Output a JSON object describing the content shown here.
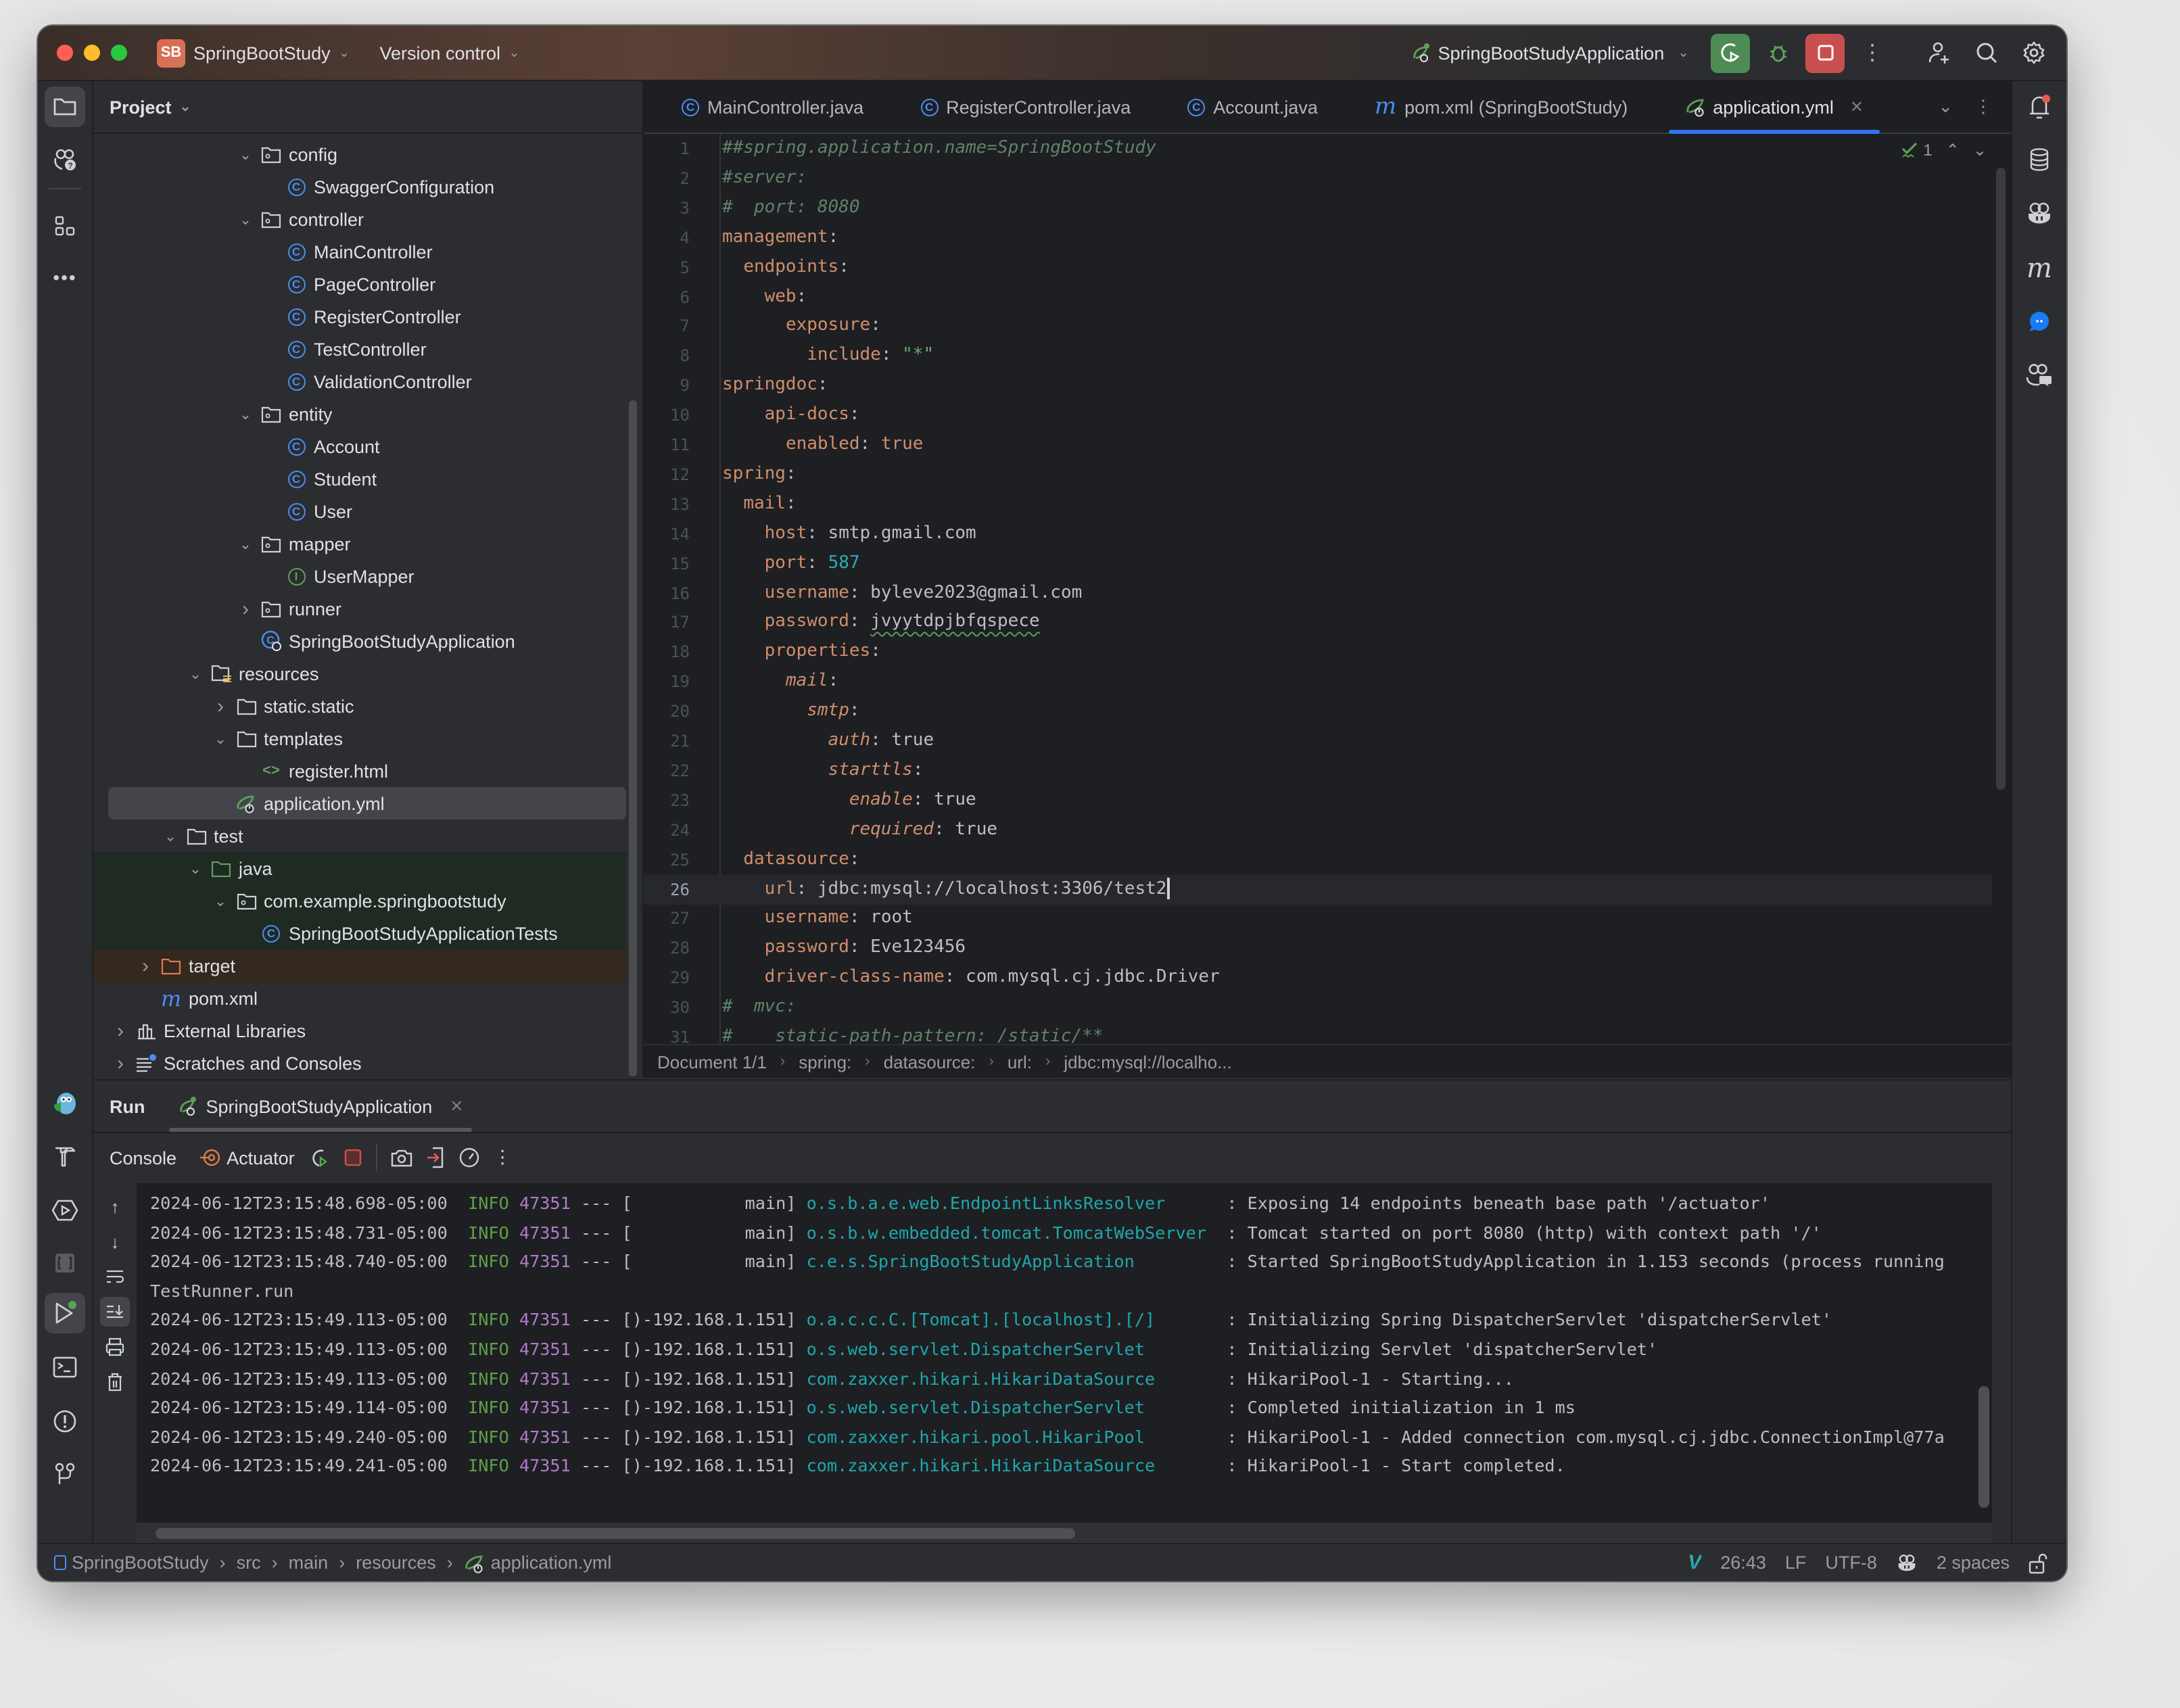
{
  "titlebar": {
    "project_badge": "SB",
    "project_name": "SpringBootStudy",
    "version_control": "Version control",
    "run_config": "SpringBootStudyApplication"
  },
  "project_panel": {
    "title": "Project",
    "tree": [
      {
        "label": "config",
        "type": "package",
        "expanded": true,
        "depth": 3
      },
      {
        "label": "SwaggerConfiguration",
        "type": "class",
        "depth": 4
      },
      {
        "label": "controller",
        "type": "package",
        "expanded": true,
        "depth": 3
      },
      {
        "label": "MainController",
        "type": "class",
        "depth": 4
      },
      {
        "label": "PageController",
        "type": "class",
        "depth": 4
      },
      {
        "label": "RegisterController",
        "type": "class",
        "depth": 4
      },
      {
        "label": "TestController",
        "type": "class",
        "depth": 4
      },
      {
        "label": "ValidationController",
        "type": "class",
        "depth": 4
      },
      {
        "label": "entity",
        "type": "package",
        "expanded": true,
        "depth": 3
      },
      {
        "label": "Account",
        "type": "class",
        "depth": 4
      },
      {
        "label": "Student",
        "type": "class",
        "depth": 4
      },
      {
        "label": "User",
        "type": "class",
        "depth": 4
      },
      {
        "label": "mapper",
        "type": "package",
        "expanded": true,
        "depth": 3
      },
      {
        "label": "UserMapper",
        "type": "interface",
        "depth": 4
      },
      {
        "label": "runner",
        "type": "package",
        "expanded": false,
        "depth": 3
      },
      {
        "label": "SpringBootStudyApplication",
        "type": "spring-class",
        "depth": 3
      },
      {
        "label": "resources",
        "type": "resources",
        "expanded": true,
        "depth": 1
      },
      {
        "label": "static.static",
        "type": "folder",
        "expanded": false,
        "depth": 2
      },
      {
        "label": "templates",
        "type": "folder",
        "expanded": true,
        "depth": 2
      },
      {
        "label": "register.html",
        "type": "html",
        "depth": 3
      },
      {
        "label": "application.yml",
        "type": "spring-yml",
        "depth": 2,
        "selected": true
      },
      {
        "label": "test",
        "type": "folder",
        "expanded": true,
        "depth": 0
      },
      {
        "label": "java",
        "type": "test-folder",
        "expanded": true,
        "depth": 1,
        "test": true
      },
      {
        "label": "com.example.springbootstudy",
        "type": "package",
        "expanded": true,
        "depth": 2,
        "test": true
      },
      {
        "label": "SpringBootStudyApplicationTests",
        "type": "class",
        "depth": 3,
        "test": true
      },
      {
        "label": "target",
        "type": "excluded-folder",
        "expanded": false,
        "depth": -1,
        "excluded": true
      },
      {
        "label": "pom.xml",
        "type": "maven",
        "depth": -1
      },
      {
        "label": "External Libraries",
        "type": "libraries",
        "expanded": false,
        "depth": -2
      },
      {
        "label": "Scratches and Consoles",
        "type": "scratches",
        "expanded": false,
        "depth": -2
      }
    ]
  },
  "editor": {
    "tabs": [
      {
        "label": "MainController.java",
        "icon": "class"
      },
      {
        "label": "RegisterController.java",
        "icon": "class"
      },
      {
        "label": "Account.java",
        "icon": "class"
      },
      {
        "label": "pom.xml (SpringBootStudy)",
        "icon": "maven"
      },
      {
        "label": "application.yml",
        "icon": "spring-yml",
        "active": true
      }
    ],
    "inspection_count": "1",
    "current_line": 26,
    "lines": [
      [
        {
          "t": "##spring.application.name=SpringBootStudy",
          "c": "cm"
        }
      ],
      [
        {
          "t": "#server:",
          "c": "cm"
        }
      ],
      [
        {
          "t": "#  port: 8080",
          "c": "cm"
        }
      ],
      [
        {
          "t": "management",
          "c": "k"
        },
        {
          "t": ":"
        }
      ],
      [
        {
          "t": "  "
        },
        {
          "t": "endpoints",
          "c": "k"
        },
        {
          "t": ":"
        }
      ],
      [
        {
          "t": "    "
        },
        {
          "t": "web",
          "c": "k"
        },
        {
          "t": ":"
        }
      ],
      [
        {
          "t": "      "
        },
        {
          "t": "exposure",
          "c": "k"
        },
        {
          "t": ":"
        }
      ],
      [
        {
          "t": "        "
        },
        {
          "t": "include",
          "c": "k"
        },
        {
          "t": ": "
        },
        {
          "t": "\"*\"",
          "c": "str"
        }
      ],
      [
        {
          "t": "springdoc",
          "c": "k"
        },
        {
          "t": ":"
        }
      ],
      [
        {
          "t": "    "
        },
        {
          "t": "api-docs",
          "c": "k"
        },
        {
          "t": ":"
        }
      ],
      [
        {
          "t": "      "
        },
        {
          "t": "enabled",
          "c": "k"
        },
        {
          "t": ": "
        },
        {
          "t": "true",
          "c": "kw"
        }
      ],
      [
        {
          "t": "spring",
          "c": "k"
        },
        {
          "t": ":"
        }
      ],
      [
        {
          "t": "  "
        },
        {
          "t": "mail",
          "c": "k"
        },
        {
          "t": ":"
        }
      ],
      [
        {
          "t": "    "
        },
        {
          "t": "host",
          "c": "k"
        },
        {
          "t": ": smtp.gmail.com"
        }
      ],
      [
        {
          "t": "    "
        },
        {
          "t": "port",
          "c": "k"
        },
        {
          "t": ": "
        },
        {
          "t": "587",
          "c": "num"
        }
      ],
      [
        {
          "t": "    "
        },
        {
          "t": "username",
          "c": "k"
        },
        {
          "t": ": byleve2023@gmail.com"
        }
      ],
      [
        {
          "t": "    "
        },
        {
          "t": "password",
          "c": "k"
        },
        {
          "t": ": "
        },
        {
          "t": "jvyytdpjbfqspece",
          "c": "typo"
        }
      ],
      [
        {
          "t": "    "
        },
        {
          "t": "properties",
          "c": "k"
        },
        {
          "t": ":"
        }
      ],
      [
        {
          "t": "      "
        },
        {
          "t": "mail",
          "c": "k i"
        },
        {
          "t": ":"
        }
      ],
      [
        {
          "t": "        "
        },
        {
          "t": "smtp",
          "c": "k i"
        },
        {
          "t": ":"
        }
      ],
      [
        {
          "t": "          "
        },
        {
          "t": "auth",
          "c": "k i"
        },
        {
          "t": ": true"
        }
      ],
      [
        {
          "t": "          "
        },
        {
          "t": "starttls",
          "c": "k i"
        },
        {
          "t": ":"
        }
      ],
      [
        {
          "t": "            "
        },
        {
          "t": "enable",
          "c": "k i"
        },
        {
          "t": ": true"
        }
      ],
      [
        {
          "t": "            "
        },
        {
          "t": "required",
          "c": "k i"
        },
        {
          "t": ": true"
        }
      ],
      [
        {
          "t": "  "
        },
        {
          "t": "datasource",
          "c": "k"
        },
        {
          "t": ":"
        }
      ],
      [
        {
          "t": "    "
        },
        {
          "t": "url",
          "c": "k"
        },
        {
          "t": ": jdbc:mysql://localhost:3306/test2"
        }
      ],
      [
        {
          "t": "    "
        },
        {
          "t": "username",
          "c": "k"
        },
        {
          "t": ": root"
        }
      ],
      [
        {
          "t": "    "
        },
        {
          "t": "password",
          "c": "k"
        },
        {
          "t": ": Eve123456"
        }
      ],
      [
        {
          "t": "    "
        },
        {
          "t": "driver-class-name",
          "c": "k"
        },
        {
          "t": ": com.mysql.cj.jdbc.Driver"
        }
      ],
      [
        {
          "t": "#  mvc:",
          "c": "cm"
        }
      ],
      [
        {
          "t": "#    static-path-pattern: /static/**",
          "c": "cm"
        }
      ]
    ],
    "breadcrumbs": [
      "Document 1/1",
      "spring:",
      "datasource:",
      "url:",
      "jdbc:mysql://localho..."
    ]
  },
  "run_panel": {
    "title": "Run",
    "tab_label": "SpringBootStudyApplication",
    "console_label": "Console",
    "actuator_label": "Actuator",
    "log": [
      {
        "ts": "2024-06-12T23:15:48.698-05:00",
        "level": "INFO",
        "pid": "47351",
        "thread": "[           main]",
        "logger": "o.s.b.a.e.web.EndpointLinksResolver     ",
        "msg": ": Exposing 14 endpoints beneath base path '/actuator'"
      },
      {
        "ts": "2024-06-12T23:15:48.731-05:00",
        "level": "INFO",
        "pid": "47351",
        "thread": "[           main]",
        "logger": "o.s.b.w.embedded.tomcat.TomcatWebServer ",
        "msg": ": Tomcat started on port 8080 (http) with context path '/'"
      },
      {
        "ts": "2024-06-12T23:15:48.740-05:00",
        "level": "INFO",
        "pid": "47351",
        "thread": "[           main]",
        "logger": "c.e.s.SpringBootStudyApplication        ",
        "msg": ": Started SpringBootStudyApplication in 1.153 seconds (process running"
      },
      {
        "raw": "TestRunner.run"
      },
      {
        "ts": "2024-06-12T23:15:49.113-05:00",
        "level": "INFO",
        "pid": "47351",
        "thread": "[)-192.168.1.151]",
        "logger": "o.a.c.c.C.[Tomcat].[localhost].[/]      ",
        "msg": ": Initializing Spring DispatcherServlet 'dispatcherServlet'"
      },
      {
        "ts": "2024-06-12T23:15:49.113-05:00",
        "level": "INFO",
        "pid": "47351",
        "thread": "[)-192.168.1.151]",
        "logger": "o.s.web.servlet.DispatcherServlet       ",
        "msg": ": Initializing Servlet 'dispatcherServlet'"
      },
      {
        "ts": "2024-06-12T23:15:49.113-05:00",
        "level": "INFO",
        "pid": "47351",
        "thread": "[)-192.168.1.151]",
        "logger": "com.zaxxer.hikari.HikariDataSource      ",
        "msg": ": HikariPool-1 - Starting..."
      },
      {
        "ts": "2024-06-12T23:15:49.114-05:00",
        "level": "INFO",
        "pid": "47351",
        "thread": "[)-192.168.1.151]",
        "logger": "o.s.web.servlet.DispatcherServlet       ",
        "msg": ": Completed initialization in 1 ms"
      },
      {
        "ts": "2024-06-12T23:15:49.240-05:00",
        "level": "INFO",
        "pid": "47351",
        "thread": "[)-192.168.1.151]",
        "logger": "com.zaxxer.hikari.pool.HikariPool       ",
        "msg": ": HikariPool-1 - Added connection com.mysql.cj.jdbc.ConnectionImpl@77a"
      },
      {
        "ts": "2024-06-12T23:15:49.241-05:00",
        "level": "INFO",
        "pid": "47351",
        "thread": "[)-192.168.1.151]",
        "logger": "com.zaxxer.hikari.HikariDataSource      ",
        "msg": ": HikariPool-1 - Start completed."
      }
    ]
  },
  "statusbar": {
    "path": [
      "SpringBootStudy",
      "src",
      "main",
      "resources",
      "application.yml"
    ],
    "position": "26:43",
    "line_ending": "LF",
    "encoding": "UTF-8",
    "indent": "2 spaces"
  },
  "colors": {
    "accent": "#3574f0",
    "run_green": "#4e8b55",
    "stop_red": "#c94f4f",
    "yaml_key": "#cf8e6d",
    "comment": "#5f826b",
    "log_logger": "#1ea7ad",
    "log_pid": "#b17ac7",
    "log_level": "#5ea04a"
  }
}
